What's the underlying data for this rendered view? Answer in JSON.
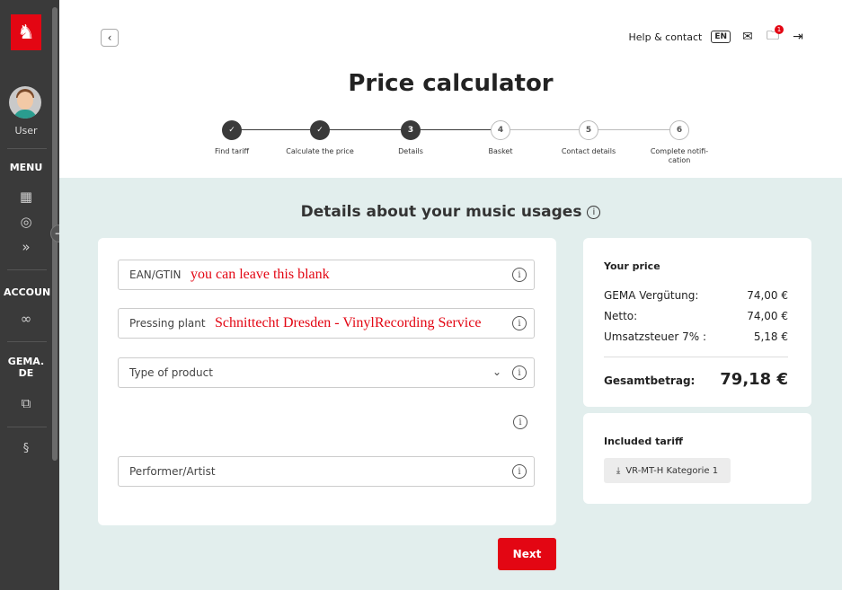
{
  "sidebar": {
    "user_label": "User",
    "menu_label": "MENU",
    "account_label": "ACCOUN",
    "gema_label": "GEMA.\nDE",
    "section_icon": "§"
  },
  "topbar": {
    "help": "Help & contact",
    "lang": "EN",
    "badge": "1"
  },
  "page": {
    "title": "Price calculator"
  },
  "steps": [
    {
      "num": "✓",
      "label": "Find tariff",
      "state": "done"
    },
    {
      "num": "✓",
      "label": "Calculate the price",
      "state": "done"
    },
    {
      "num": "3",
      "label": "Details",
      "state": "current"
    },
    {
      "num": "4",
      "label": "Basket",
      "state": "todo"
    },
    {
      "num": "5",
      "label": "Contact details",
      "state": "todo"
    },
    {
      "num": "6",
      "label": "Complete notifi-cation",
      "state": "todo"
    }
  ],
  "section": {
    "title": "Details about your music usages"
  },
  "form": {
    "ean_label": "EAN/GTIN",
    "ean_note": "you can leave this blank",
    "pressing_label": "Pressing plant",
    "pressing_value": "Schnittecht Dresden - VinylRecording Service",
    "product_label": "Type of product",
    "performer_label": "Performer/Artist"
  },
  "price": {
    "heading": "Your price",
    "rows": [
      {
        "label": "GEMA Vergütung:",
        "value": "74,00 €"
      },
      {
        "label": "Netto:",
        "value": "74,00 €"
      },
      {
        "label": "Umsatzsteuer 7% :",
        "value": "5,18 €"
      }
    ],
    "total_label": "Gesamtbetrag:",
    "total_value": "79,18 €"
  },
  "tariff": {
    "heading": "Included tariff",
    "item": "VR-MT-H Kategorie 1"
  },
  "actions": {
    "next": "Next"
  },
  "colors": {
    "accent": "#e30613",
    "background": "#e2eeed",
    "sidebar": "#3a3a3a"
  }
}
